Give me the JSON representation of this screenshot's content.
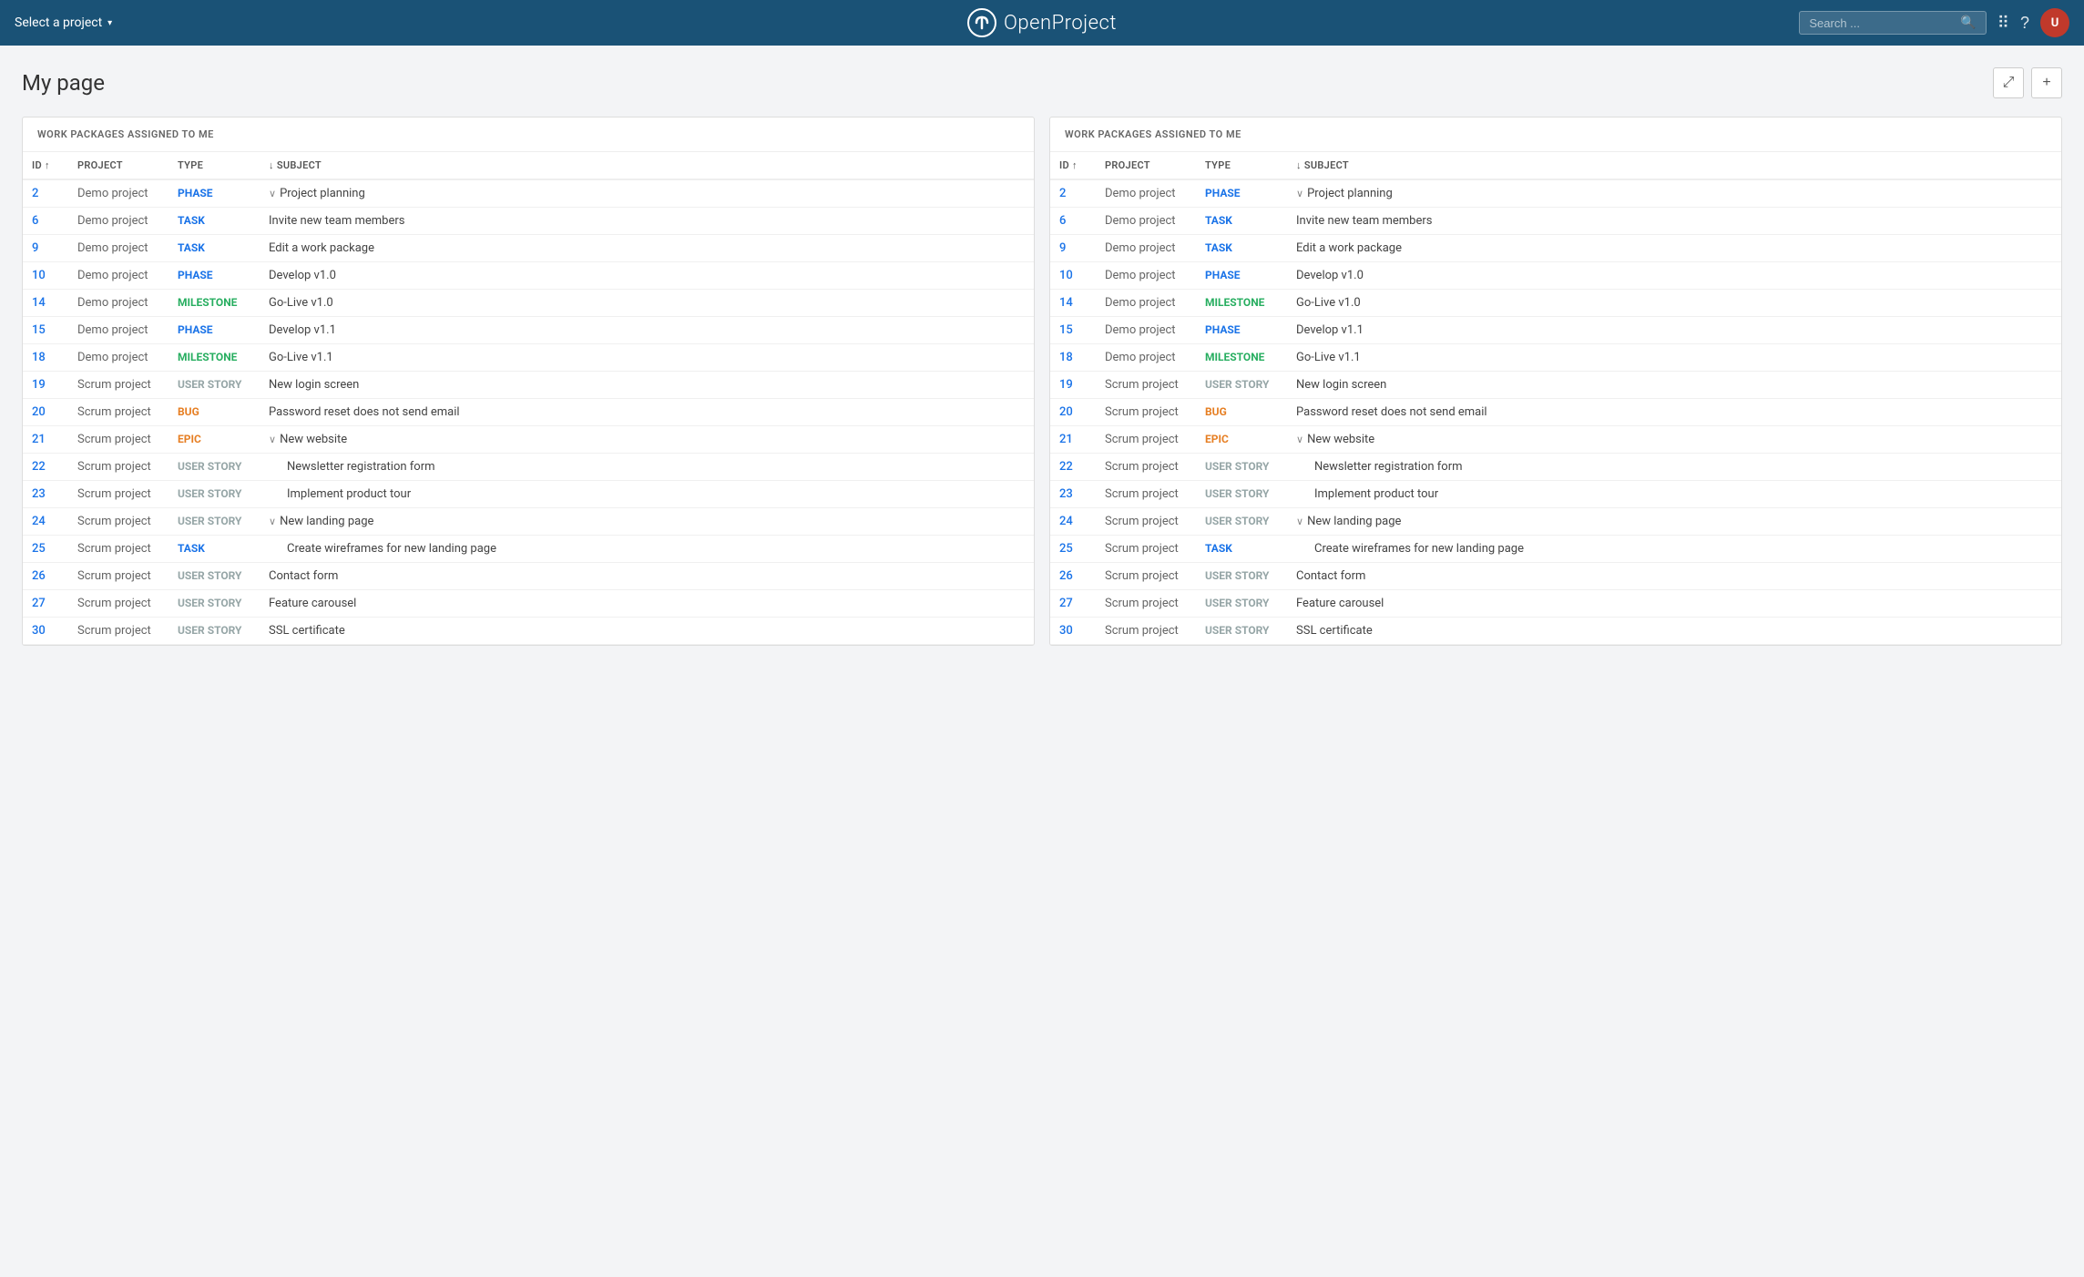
{
  "header": {
    "select_project_label": "Select a project",
    "logo_text": "OpenProject",
    "search_placeholder": "Search ...",
    "search_label": "Search"
  },
  "page": {
    "title": "My page"
  },
  "panels": [
    {
      "id": "panel-left",
      "title": "WORK PACKAGES ASSIGNED TO ME",
      "columns": {
        "id": "ID",
        "project": "PROJECT",
        "type": "TYPE",
        "subject": "SUBJECT"
      },
      "rows": [
        {
          "id": "2",
          "project": "Demo project",
          "type": "PHASE",
          "type_class": "type-phase",
          "subject": "Project planning",
          "indent": false,
          "chevron": true
        },
        {
          "id": "6",
          "project": "Demo project",
          "type": "TASK",
          "type_class": "type-task",
          "subject": "Invite new team members",
          "indent": false,
          "chevron": false
        },
        {
          "id": "9",
          "project": "Demo project",
          "type": "TASK",
          "type_class": "type-task",
          "subject": "Edit a work package",
          "indent": false,
          "chevron": false
        },
        {
          "id": "10",
          "project": "Demo project",
          "type": "PHASE",
          "type_class": "type-phase",
          "subject": "Develop v1.0",
          "indent": false,
          "chevron": false
        },
        {
          "id": "14",
          "project": "Demo project",
          "type": "MILESTONE",
          "type_class": "type-milestone",
          "subject": "Go-Live v1.0",
          "indent": false,
          "chevron": false
        },
        {
          "id": "15",
          "project": "Demo project",
          "type": "PHASE",
          "type_class": "type-phase",
          "subject": "Develop v1.1",
          "indent": false,
          "chevron": false
        },
        {
          "id": "18",
          "project": "Demo project",
          "type": "MILESTONE",
          "type_class": "type-milestone",
          "subject": "Go-Live v1.1",
          "indent": false,
          "chevron": false
        },
        {
          "id": "19",
          "project": "Scrum project",
          "type": "USER STORY",
          "type_class": "type-user-story",
          "subject": "New login screen",
          "indent": false,
          "chevron": false
        },
        {
          "id": "20",
          "project": "Scrum project",
          "type": "BUG",
          "type_class": "type-bug",
          "subject": "Password reset does not send email",
          "indent": false,
          "chevron": false
        },
        {
          "id": "21",
          "project": "Scrum project",
          "type": "EPIC",
          "type_class": "type-epic",
          "subject": "New website",
          "indent": false,
          "chevron": true
        },
        {
          "id": "22",
          "project": "Scrum project",
          "type": "USER STORY",
          "type_class": "type-user-story",
          "subject": "Newsletter registration form",
          "indent": true,
          "chevron": false
        },
        {
          "id": "23",
          "project": "Scrum project",
          "type": "USER STORY",
          "type_class": "type-user-story",
          "subject": "Implement product tour",
          "indent": true,
          "chevron": false
        },
        {
          "id": "24",
          "project": "Scrum project",
          "type": "USER STORY",
          "type_class": "type-user-story",
          "subject": "New landing page",
          "indent": false,
          "chevron": true
        },
        {
          "id": "25",
          "project": "Scrum project",
          "type": "TASK",
          "type_class": "type-task",
          "subject": "Create wireframes for new landing page",
          "indent": true,
          "chevron": false
        },
        {
          "id": "26",
          "project": "Scrum project",
          "type": "USER STORY",
          "type_class": "type-user-story",
          "subject": "Contact form",
          "indent": false,
          "chevron": false
        },
        {
          "id": "27",
          "project": "Scrum project",
          "type": "USER STORY",
          "type_class": "type-user-story",
          "subject": "Feature carousel",
          "indent": false,
          "chevron": false
        },
        {
          "id": "30",
          "project": "Scrum project",
          "type": "USER STORY",
          "type_class": "type-user-story",
          "subject": "SSL certificate",
          "indent": false,
          "chevron": false
        }
      ]
    },
    {
      "id": "panel-right",
      "title": "WORK PACKAGES ASSIGNED TO ME",
      "columns": {
        "id": "ID",
        "project": "PROJECT",
        "type": "TYPE",
        "subject": "SUBJECT"
      },
      "rows": [
        {
          "id": "2",
          "project": "Demo project",
          "type": "PHASE",
          "type_class": "type-phase",
          "subject": "Project planning",
          "indent": false,
          "chevron": true
        },
        {
          "id": "6",
          "project": "Demo project",
          "type": "TASK",
          "type_class": "type-task",
          "subject": "Invite new team members",
          "indent": false,
          "chevron": false
        },
        {
          "id": "9",
          "project": "Demo project",
          "type": "TASK",
          "type_class": "type-task",
          "subject": "Edit a work package",
          "indent": false,
          "chevron": false
        },
        {
          "id": "10",
          "project": "Demo project",
          "type": "PHASE",
          "type_class": "type-phase",
          "subject": "Develop v1.0",
          "indent": false,
          "chevron": false
        },
        {
          "id": "14",
          "project": "Demo project",
          "type": "MILESTONE",
          "type_class": "type-milestone",
          "subject": "Go-Live v1.0",
          "indent": false,
          "chevron": false
        },
        {
          "id": "15",
          "project": "Demo project",
          "type": "PHASE",
          "type_class": "type-phase",
          "subject": "Develop v1.1",
          "indent": false,
          "chevron": false
        },
        {
          "id": "18",
          "project": "Demo project",
          "type": "MILESTONE",
          "type_class": "type-milestone",
          "subject": "Go-Live v1.1",
          "indent": false,
          "chevron": false
        },
        {
          "id": "19",
          "project": "Scrum project",
          "type": "USER STORY",
          "type_class": "type-user-story",
          "subject": "New login screen",
          "indent": false,
          "chevron": false
        },
        {
          "id": "20",
          "project": "Scrum project",
          "type": "BUG",
          "type_class": "type-bug",
          "subject": "Password reset does not send email",
          "indent": false,
          "chevron": false
        },
        {
          "id": "21",
          "project": "Scrum project",
          "type": "EPIC",
          "type_class": "type-epic",
          "subject": "New website",
          "indent": false,
          "chevron": true
        },
        {
          "id": "22",
          "project": "Scrum project",
          "type": "USER STORY",
          "type_class": "type-user-story",
          "subject": "Newsletter registration form",
          "indent": true,
          "chevron": false
        },
        {
          "id": "23",
          "project": "Scrum project",
          "type": "USER STORY",
          "type_class": "type-user-story",
          "subject": "Implement product tour",
          "indent": true,
          "chevron": false
        },
        {
          "id": "24",
          "project": "Scrum project",
          "type": "USER STORY",
          "type_class": "type-user-story",
          "subject": "New landing page",
          "indent": false,
          "chevron": true
        },
        {
          "id": "25",
          "project": "Scrum project",
          "type": "TASK",
          "type_class": "type-task",
          "subject": "Create wireframes for new landing page",
          "indent": true,
          "chevron": false
        },
        {
          "id": "26",
          "project": "Scrum project",
          "type": "USER STORY",
          "type_class": "type-user-story",
          "subject": "Contact form",
          "indent": false,
          "chevron": false
        },
        {
          "id": "27",
          "project": "Scrum project",
          "type": "USER STORY",
          "type_class": "type-user-story",
          "subject": "Feature carousel",
          "indent": false,
          "chevron": false
        },
        {
          "id": "30",
          "project": "Scrum project",
          "type": "USER STORY",
          "type_class": "type-user-story",
          "subject": "SSL certificate",
          "indent": false,
          "chevron": false
        }
      ]
    }
  ],
  "actions": {
    "expand_label": "⤢",
    "add_label": "+"
  }
}
